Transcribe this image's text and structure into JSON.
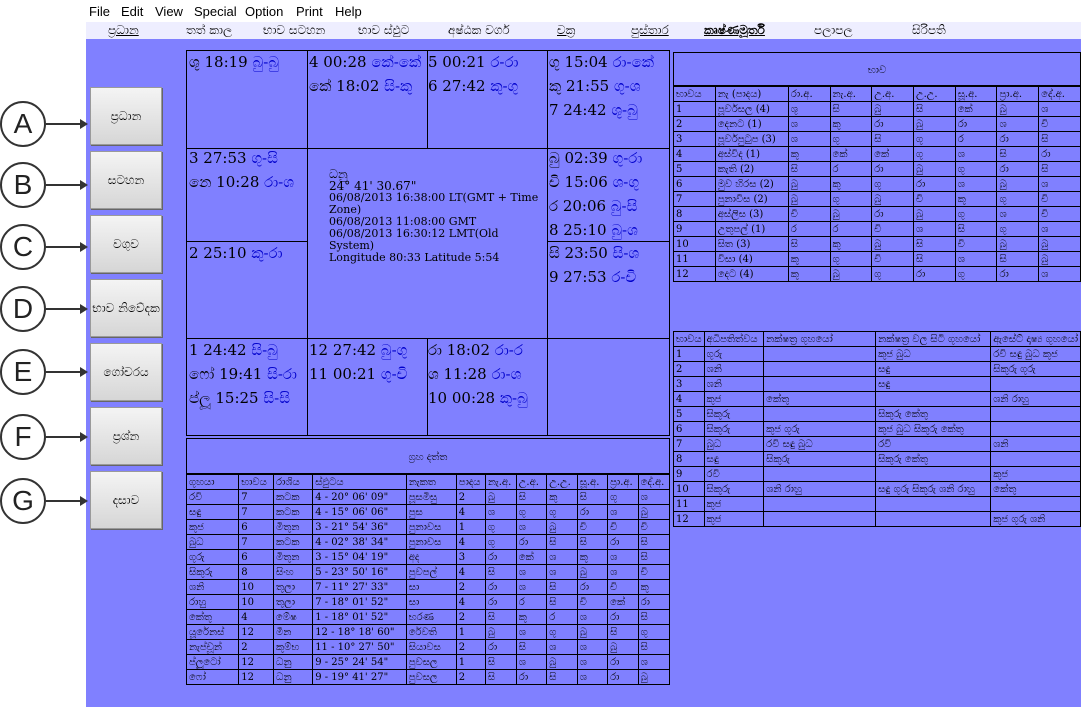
{
  "menu": [
    "File",
    "Edit",
    "View",
    "Special",
    "Option",
    "Print",
    "Help"
  ],
  "tabs": [
    "ප්‍රධාන",
    "තත් කාල",
    "භාව සටහන",
    "භාව ස්ඵුට",
    "අෂ්ඨක වර්ග",
    "චක්‍ර",
    "පුස්තාර",
    "කෘෂ්ණමූර්ති",
    "පලාපල",
    "සිරිපති"
  ],
  "side_buttons": [
    "ප්‍රධාන",
    "සටහන",
    "වගුව",
    "භාව නිවේදක",
    "ගෝචරය",
    "ප්‍රශ්න",
    "දසාව"
  ],
  "circles": [
    "A",
    "B",
    "C",
    "D",
    "E",
    "F",
    "G"
  ],
  "chart_cells": {
    "c1": [
      [
        "ශු 18:19",
        "බු-බු"
      ]
    ],
    "c2": [
      [
        "4 00:28",
        "කේ-කේ"
      ],
      [
        "කේ 18:02",
        "සි-කු"
      ]
    ],
    "c3": [
      [
        "5 00:21",
        "ර-රා"
      ],
      [
        "6 27:42",
        "කු-ගු"
      ]
    ],
    "c4": [
      [
        "ගු 15:04",
        "රා-කේ"
      ],
      [
        "කු 21:55",
        "ගු-ශ"
      ],
      [
        "7 24:42",
        "ශු-බු"
      ]
    ],
    "c5": [
      [
        "3 27:53",
        "ගු-සි"
      ],
      [
        "නෙ 10:28",
        "රා-ශ"
      ]
    ],
    "c6": [
      [
        "2 25:10",
        "කු-රා"
      ]
    ],
    "c7": [
      [
        "බු 02:39",
        "ගු-රා"
      ],
      [
        "චි 15:06",
        "ශ-ගු"
      ],
      [
        "ර 20:06",
        "බු-සි"
      ],
      [
        "8 25:10",
        "බු-ශ"
      ]
    ],
    "c8": [
      [
        "සි 23:50",
        "සි-ශ"
      ],
      [
        "9 27:53",
        "ර-චි"
      ]
    ],
    "c9": [
      [
        "1 24:42",
        "සි-බු"
      ],
      [
        "ෆෝ 19:41",
        "සි-රා"
      ],
      [
        "ප්ලූ 15:25",
        "සි-සි"
      ]
    ],
    "c10": [
      [
        "12 27:42",
        "බු-ගු"
      ],
      [
        "11 00:21",
        "ගු-චි"
      ]
    ],
    "c11": [
      [
        "රා 18:02",
        "රා-ර"
      ],
      [
        "ශ 11:28",
        "රා-ශ"
      ],
      [
        "10 00:28",
        "කු-බු"
      ]
    ]
  },
  "center_info": {
    "sign": "ධනු",
    "deg": "24° 41' 30.67\"",
    "lines": [
      "06/08/2013 16:38:00 LT(GMT + Time Zone)",
      "06/08/2013 11:08:00 GMT",
      "06/08/2013 16:30:12 LMT(Old System)",
      "Longitude 80:33  Latitude 5:54"
    ]
  },
  "bhava_table": {
    "title": "භාව",
    "headers": [
      "භාවය",
      "නැ (පාදය)",
      "රා.අ.",
      "නැ.අ.",
      "උ.අ.",
      "උ.උ.",
      "සූ.අ.",
      "ප්‍රා.අ.",
      "දේ.අ."
    ],
    "rows": [
      [
        "1",
        "පූර්වසල (4)",
        "ශු",
        "සි",
        "බු",
        "සි",
        "කේ",
        "බු",
        "ශ"
      ],
      [
        "2",
        "දෙනට (1)",
        "ශ",
        "කු",
        "රා",
        "බු",
        "රා",
        "ශ",
        "චි"
      ],
      [
        "3",
        "පූර්වපුටුප (3)",
        "ශ",
        "ගු",
        "සි",
        "ගු",
        "ර",
        "රා",
        "සි"
      ],
      [
        "4",
        "අස්විද (1)",
        "කු",
        "කේ",
        "කේ",
        "ගු",
        "ශ",
        "සි",
        "රා"
      ],
      [
        "5",
        "කැති (2)",
        "සි",
        "ර",
        "රා",
        "බු",
        "ගු",
        "රා",
        "සි"
      ],
      [
        "6",
        "මුව හිරස (2)",
        "බු",
        "කු",
        "ගු",
        "රා",
        "ශ",
        "බු",
        "ශ"
      ],
      [
        "7",
        "පුනාවිස (2)",
        "බු",
        "ගු",
        "බු",
        "චි",
        "කු",
        "ගු",
        "චි"
      ],
      [
        "8",
        "අස්ලිස (3)",
        "චි",
        "බු",
        "රා",
        "බු",
        "ගු",
        "ශ",
        "චි"
      ],
      [
        "9",
        "උතුපල් (1)",
        "ර",
        "ර",
        "චි",
        "ශ",
        "සි",
        "ගු",
        "ශ"
      ],
      [
        "10",
        "සිත (3)",
        "සි",
        "කු",
        "බු",
        "සි",
        "චි",
        "බු",
        "බු"
      ],
      [
        "11",
        "විසා (4)",
        "කු",
        "ගු",
        "චි",
        "සි",
        "ශ",
        "සි",
        "බු"
      ],
      [
        "12",
        "දෙට (4)",
        "කු",
        "බු",
        "ගු",
        "රා",
        "ගු",
        "රා",
        "ශ"
      ]
    ]
  },
  "occupant_table": {
    "headers": [
      "භාවය",
      "අධිපතිත්වය",
      "නක්ෂත්‍ර ගුහයෝ",
      "නක්ෂත්‍ර වල සිටි ගුහයෝ",
      "ඇසේට් දෘෂ්‍ය ගුහයෝ"
    ],
    "rows": [
      [
        "1",
        "ගුරු",
        "",
        "කුජ බුධ",
        "රවි සඳු බුධ කුජ"
      ],
      [
        "2",
        "ශනි",
        "",
        "සඳු",
        "සිකුරු ගුරු"
      ],
      [
        "3",
        "ශනි",
        "",
        "සඳු",
        ""
      ],
      [
        "4",
        "කුජ",
        "කේතු",
        "",
        "ශනි රාහු"
      ],
      [
        "5",
        "සිකුරු",
        "",
        "සිකුරු කේතු",
        ""
      ],
      [
        "6",
        "සිකුරු",
        "කුජ ගුරු",
        "කුජ බුධ සිකුරු කේතු",
        ""
      ],
      [
        "7",
        "බුධ",
        "රවි සඳු බුධ",
        "රවි",
        "ශනි"
      ],
      [
        "8",
        "සඳු",
        "සිකුරු",
        "සිකුරු කේතු",
        ""
      ],
      [
        "9",
        "රවි",
        "",
        "",
        "කුජ"
      ],
      [
        "10",
        "සිකුරු",
        "ශනි රාහු",
        "සඳු ගුරු සිකුරු ශනි රාහු",
        "කේතු"
      ],
      [
        "11",
        "කුජ",
        "",
        "",
        ""
      ],
      [
        "12",
        "කුජ",
        "",
        "",
        "කුජ ගුරු ශනි"
      ]
    ]
  },
  "planet_table": {
    "title": "ග්‍රහ දත්ත",
    "headers": [
      "ගුහයා",
      "භාවය",
      "රාශිය",
      "ස්ඵුටය",
      "නැකත",
      "පාදය",
      "නැ.අ.",
      "උ.අ.",
      "උ.උ.",
      "සූ.අ.",
      "ප්‍රා.අ.",
      "දේ.අ."
    ],
    "rows": [
      [
        "රවි",
        "7",
        "කටක",
        "4 - 20° 06' 09\"",
        "පූසමිසු",
        "2",
        "බු",
        "සි",
        "කු",
        "සි",
        "ගු",
        "ශ"
      ],
      [
        "සඳු",
        "7",
        "කටක",
        "4 - 15° 06' 06\"",
        "පුස",
        "4",
        "ශ",
        "ගු",
        "ගු",
        "රා",
        "ශ",
        "බු"
      ],
      [
        "කුජ",
        "6",
        "මිතුන",
        "3 - 21° 54' 36\"",
        "පුනාවස",
        "1",
        "ගු",
        "ශ",
        "බු",
        "චි",
        "චි",
        "චි"
      ],
      [
        "බුධ",
        "7",
        "කටක",
        "4 - 02° 38' 34\"",
        "පුනාවස",
        "4",
        "ගු",
        "රා",
        "සි",
        "සි",
        "රා",
        "සි"
      ],
      [
        "ගුරු",
        "6",
        "මිතුන",
        "3 - 15° 04' 19\"",
        "අද",
        "3",
        "රා",
        "කේ",
        "ශ",
        "කු",
        "ශ",
        "සි"
      ],
      [
        "සිකුරු",
        "8",
        "සිංහ",
        "5 - 23° 50' 16\"",
        "පුවපල්",
        "4",
        "සි",
        "ශ",
        "ශ",
        "බු",
        "ශ",
        "චි"
      ],
      [
        "ශනි",
        "10",
        "තුලා",
        "7 - 11° 27' 33\"",
        "සා",
        "2",
        "රා",
        "ශ",
        "සි",
        "රා",
        "චි",
        "කු"
      ],
      [
        "රාහු",
        "10",
        "තුලා",
        "7 - 18° 01' 52\"",
        "සා",
        "4",
        "රා",
        "ර",
        "සි",
        "චි",
        "කේ",
        "රා"
      ],
      [
        "කේතු",
        "4",
        "මේෂ",
        "1 - 18° 01' 52\"",
        "භරණ",
        "2",
        "සි",
        "කු",
        "ර",
        "ශ",
        "රා",
        "සි"
      ],
      [
        "යූරේනස්",
        "12",
        "මීන",
        "12 - 18° 18' 60\"",
        "රේවති",
        "1",
        "බු",
        "ශ",
        "ගු",
        "බු",
        "සි",
        "ගු"
      ],
      [
        "නැප්චූන්",
        "2",
        "කුම්භ",
        "11 - 10° 27' 50\"",
        "සියාවස",
        "2",
        "රා",
        "සි",
        "ශ",
        "ශ",
        "බු",
        "සි"
      ],
      [
        "ප්ලූටෝ",
        "12",
        "ධනු",
        "9 - 25° 24' 54\"",
        "පුවසල",
        "1",
        "සි",
        "ශ",
        "බු",
        "ශ",
        "රා",
        "ශ"
      ],
      [
        "ෆෝ",
        "12",
        "ධනු",
        "9 - 19° 41' 27\"",
        "පුවසල",
        "2",
        "සි",
        "රා",
        "සි",
        "ශ",
        "රා",
        "බු"
      ]
    ]
  },
  "colors": {
    "background": "#8080ff",
    "blue_text": "#0000cc"
  }
}
